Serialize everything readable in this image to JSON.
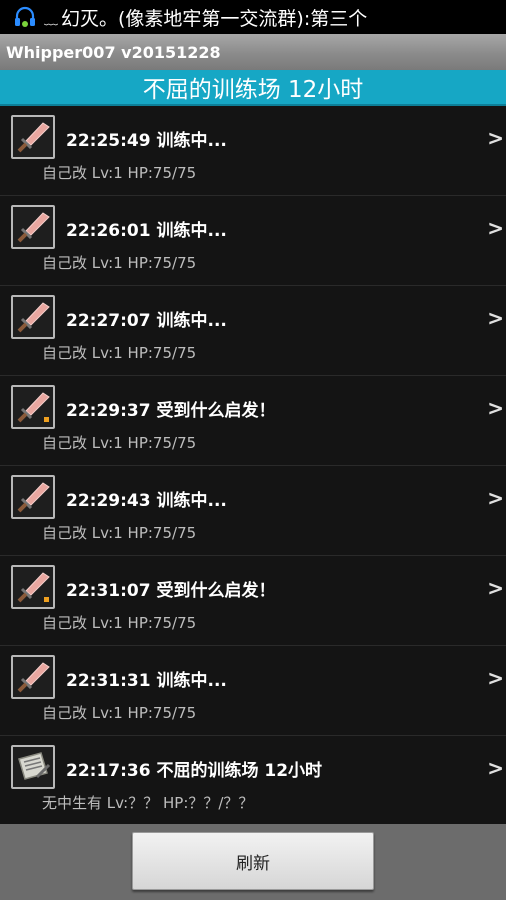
{
  "status_bar": {
    "notification_text": "幻灭。(像素地牢第一交流群):第三个",
    "headset_icon": "headset-icon",
    "dots_icon": "chat-dots-icon"
  },
  "app": {
    "title": "Whipper007 v20151228"
  },
  "header": {
    "title": "不屈的训练场 12小时"
  },
  "colors": {
    "header_bg": "#16a7c5",
    "list_bg": "#141414",
    "footer_bg": "#6c6c6c"
  },
  "entries": [
    {
      "icon": "sword-icon",
      "title": "22:25:49 训练中...",
      "subtitle": "自己改  Lv:1  HP:75/75",
      "chevron": ">"
    },
    {
      "icon": "sword-icon",
      "title": "22:26:01 训练中...",
      "subtitle": "自己改  Lv:1  HP:75/75",
      "chevron": ">"
    },
    {
      "icon": "sword-icon",
      "title": "22:27:07 训练中...",
      "subtitle": "自己改  Lv:1  HP:75/75",
      "chevron": ">"
    },
    {
      "icon": "sword-spark-icon",
      "title": "22:29:37 受到什么启发！",
      "subtitle": "自己改  Lv:1  HP:75/75",
      "chevron": ">"
    },
    {
      "icon": "sword-icon",
      "title": "22:29:43 训练中...",
      "subtitle": "自己改  Lv:1  HP:75/75",
      "chevron": ">"
    },
    {
      "icon": "sword-spark-icon",
      "title": "22:31:07 受到什么启发！",
      "subtitle": "自己改  Lv:1  HP:75/75",
      "chevron": ">"
    },
    {
      "icon": "sword-icon",
      "title": "22:31:31 训练中...",
      "subtitle": "自己改  Lv:1  HP:75/75",
      "chevron": ">"
    },
    {
      "icon": "scroll-icon",
      "title": "22:17:36 不屈的训练场 12小时",
      "subtitle": "无中生有 Lv:？？  HP:？？/？？",
      "chevron": ">"
    }
  ],
  "footer": {
    "refresh_label": "刷新"
  }
}
